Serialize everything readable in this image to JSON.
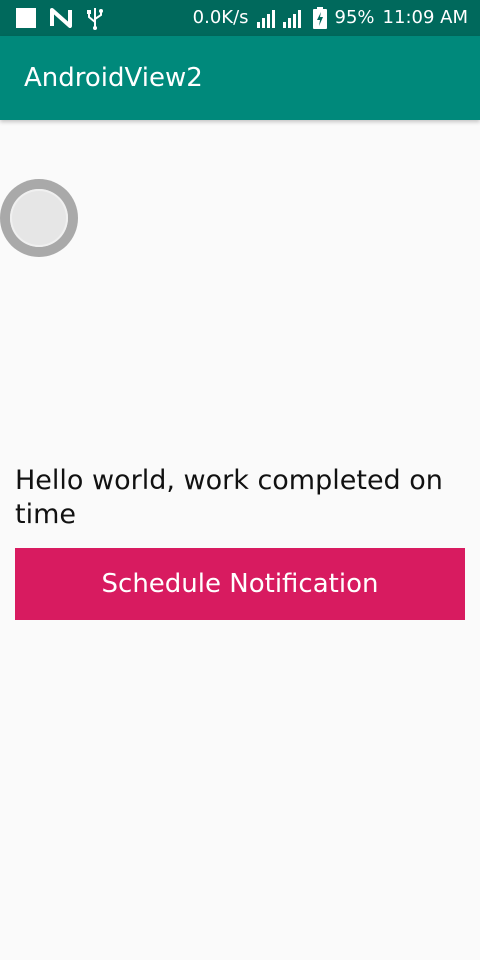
{
  "status_bar": {
    "net_speed": "0.0K/s",
    "battery": "95%",
    "time": "11:09 AM",
    "icons": [
      "square-notification-icon",
      "n-notification-icon",
      "usb-icon",
      "signal-icon",
      "battery-icon"
    ]
  },
  "app_bar": {
    "title": "AndroidView2"
  },
  "main": {
    "message": "Hello world, work completed on time",
    "button_label": "Schedule Notification"
  },
  "colors": {
    "status_bar": "#00695c",
    "app_bar": "#00897b",
    "accent": "#d81b60",
    "background": "#fafafa"
  }
}
